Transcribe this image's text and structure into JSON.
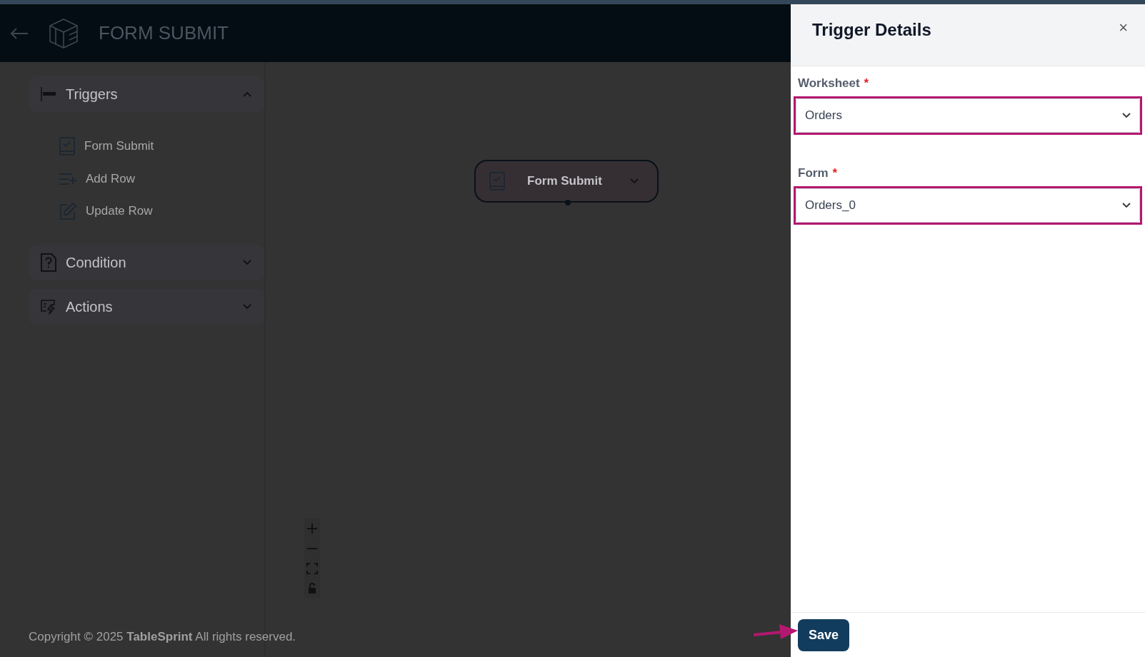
{
  "header": {
    "title": "FORM SUBMIT"
  },
  "sidebar": {
    "sections": [
      {
        "title": "Triggers",
        "expanded": true,
        "items": [
          {
            "label": "Form Submit"
          },
          {
            "label": "Add Row"
          },
          {
            "label": "Update Row"
          }
        ]
      },
      {
        "title": "Condition",
        "expanded": false
      },
      {
        "title": "Actions",
        "expanded": false
      }
    ]
  },
  "canvas": {
    "node": {
      "label": "Form Submit"
    }
  },
  "footer": {
    "copyright": "Copyright © 2025 **TableSprint** All rights reserved."
  },
  "panel": {
    "title": "Trigger Details",
    "close": "×",
    "fields": [
      {
        "label": "Worksheet",
        "required_mark": "*",
        "value": "Orders",
        "highlighted": true
      },
      {
        "label": "Form",
        "required_mark": "*",
        "value": "Orders_0",
        "highlighted": true
      }
    ],
    "save_button": "Save",
    "save_highlighted": true
  }
}
